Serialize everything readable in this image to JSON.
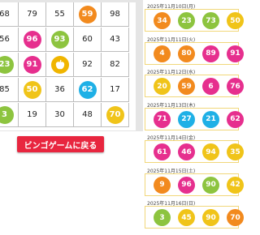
{
  "board": {
    "rows": [
      [
        {
          "n": "68"
        },
        {
          "n": "79"
        },
        {
          "n": "55"
        },
        {
          "n": "59",
          "c": "#f28a1e"
        },
        {
          "n": "98"
        }
      ],
      [
        {
          "n": "56"
        },
        {
          "n": "96",
          "c": "#e62f8e"
        },
        {
          "n": "93",
          "c": "#8dc43f"
        },
        {
          "n": "60"
        },
        {
          "n": "43"
        }
      ],
      [
        {
          "n": "23",
          "c": "#8dc43f"
        },
        {
          "n": "91",
          "c": "#e62f8e"
        },
        {
          "n": "FREE",
          "free": true
        },
        {
          "n": "92"
        },
        {
          "n": "82"
        }
      ],
      [
        {
          "n": "85"
        },
        {
          "n": "50",
          "c": "#f0c419"
        },
        {
          "n": "36"
        },
        {
          "n": "62",
          "c": "#1fb0e6"
        },
        {
          "n": "17"
        }
      ],
      [
        {
          "n": "3",
          "c": "#8dc43f"
        },
        {
          "n": "19"
        },
        {
          "n": "30"
        },
        {
          "n": "48"
        },
        {
          "n": "70",
          "c": "#f0c419"
        }
      ]
    ]
  },
  "back_button": {
    "label": "ビンゴゲームに戻る"
  },
  "history": [
    {
      "date": "2025年11月10日(月)",
      "balls": [
        {
          "n": "34",
          "c": "#f28a1e"
        },
        {
          "n": "23",
          "c": "#8dc43f"
        },
        {
          "n": "73",
          "c": "#8dc43f"
        },
        {
          "n": "50",
          "c": "#f0c419"
        }
      ]
    },
    {
      "date": "2025年11月11日(火)",
      "balls": [
        {
          "n": "4",
          "c": "#f28a1e"
        },
        {
          "n": "80",
          "c": "#f28a1e"
        },
        {
          "n": "89",
          "c": "#e62f8e"
        },
        {
          "n": "91",
          "c": "#e62f8e"
        }
      ]
    },
    {
      "date": "2025年11月12日(水)",
      "balls": [
        {
          "n": "20",
          "c": "#f0c419"
        },
        {
          "n": "59",
          "c": "#f28a1e"
        },
        {
          "n": "6",
          "c": "#e62f8e"
        },
        {
          "n": "76",
          "c": "#e62f8e"
        }
      ]
    },
    {
      "date": "2025年11月13日(木)",
      "balls": [
        {
          "n": "71",
          "c": "#e62f8e"
        },
        {
          "n": "27",
          "c": "#1fb0e6"
        },
        {
          "n": "21",
          "c": "#1fb0e6"
        },
        {
          "n": "62",
          "c": "#e62f8e"
        }
      ]
    },
    {
      "date": "2025年11月14日(金)",
      "balls": [
        {
          "n": "61",
          "c": "#e62f8e"
        },
        {
          "n": "46",
          "c": "#e62f8e"
        },
        {
          "n": "94",
          "c": "#f0c419"
        },
        {
          "n": "35",
          "c": "#f0c419"
        }
      ]
    },
    {
      "date": "2025年11月15日(土)",
      "balls": [
        {
          "n": "9",
          "c": "#f28a1e"
        },
        {
          "n": "96",
          "c": "#e62f8e"
        },
        {
          "n": "90",
          "c": "#8dc43f"
        },
        {
          "n": "42",
          "c": "#f0c419"
        }
      ]
    },
    {
      "date": "2025年11月16日(日)",
      "balls": [
        {
          "n": "3",
          "c": "#8dc43f"
        },
        {
          "n": "45",
          "c": "#f0c419"
        },
        {
          "n": "90",
          "c": "#f0c419"
        },
        {
          "n": "70",
          "c": "#f28a1e"
        }
      ]
    }
  ]
}
